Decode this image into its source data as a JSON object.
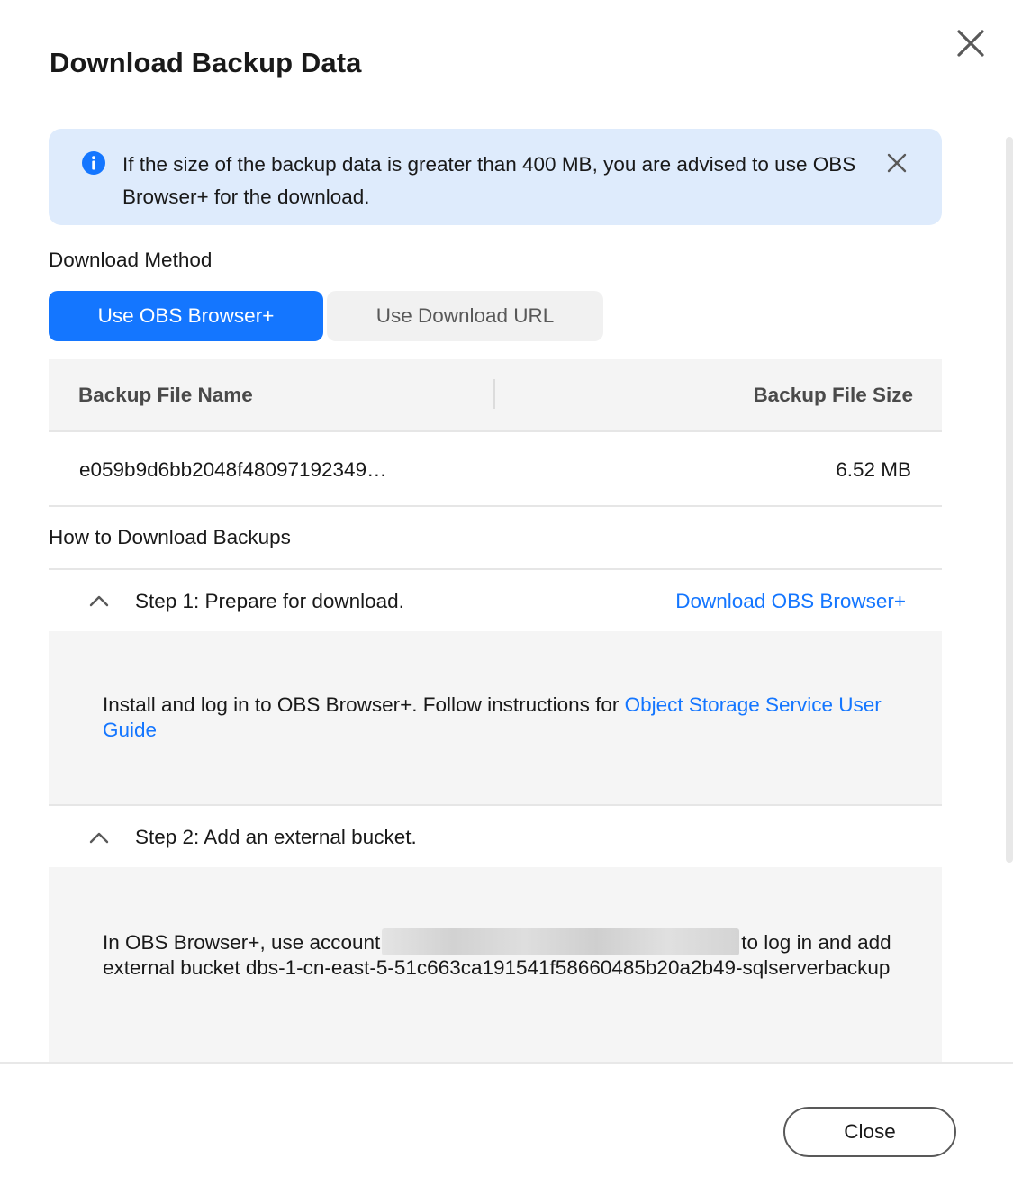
{
  "dialog": {
    "title": "Download Backup Data"
  },
  "alert": {
    "text": "If the size of the backup data is greater than 400 MB, you are advised to use OBS Browser+ for the download."
  },
  "method": {
    "label": "Download Method",
    "options": [
      "Use OBS Browser+",
      "Use Download URL"
    ],
    "selected": "Use OBS Browser+"
  },
  "table": {
    "columns": [
      "Backup File Name",
      "Backup File Size"
    ],
    "rows": [
      {
        "name": "e059b9d6bb2048f48097192349…",
        "size": "6.52 MB"
      }
    ]
  },
  "howto": {
    "label": "How to Download Backups",
    "step1": {
      "title": "Step 1: Prepare for download.",
      "link": "Download OBS Browser+",
      "text_before": "Install and log in to OBS Browser+. Follow instructions for ",
      "text_link": "Object Storage Service User Guide"
    },
    "step2": {
      "title": "Step 2: Add an external bucket.",
      "text_before": "In OBS Browser+, use account",
      "text_after": "to log in and add external bucket dbs-1-cn-east-5-51c663ca191541f58660485b20a2b49-sqlserverbackup"
    }
  },
  "footer": {
    "close_label": "Close"
  },
  "colors": {
    "accent": "#1476ff",
    "alert_bg": "#deebfc",
    "text": "#191919"
  },
  "icons": [
    "close-icon",
    "info-icon",
    "alert-close-icon",
    "chevron-up-icon"
  ]
}
